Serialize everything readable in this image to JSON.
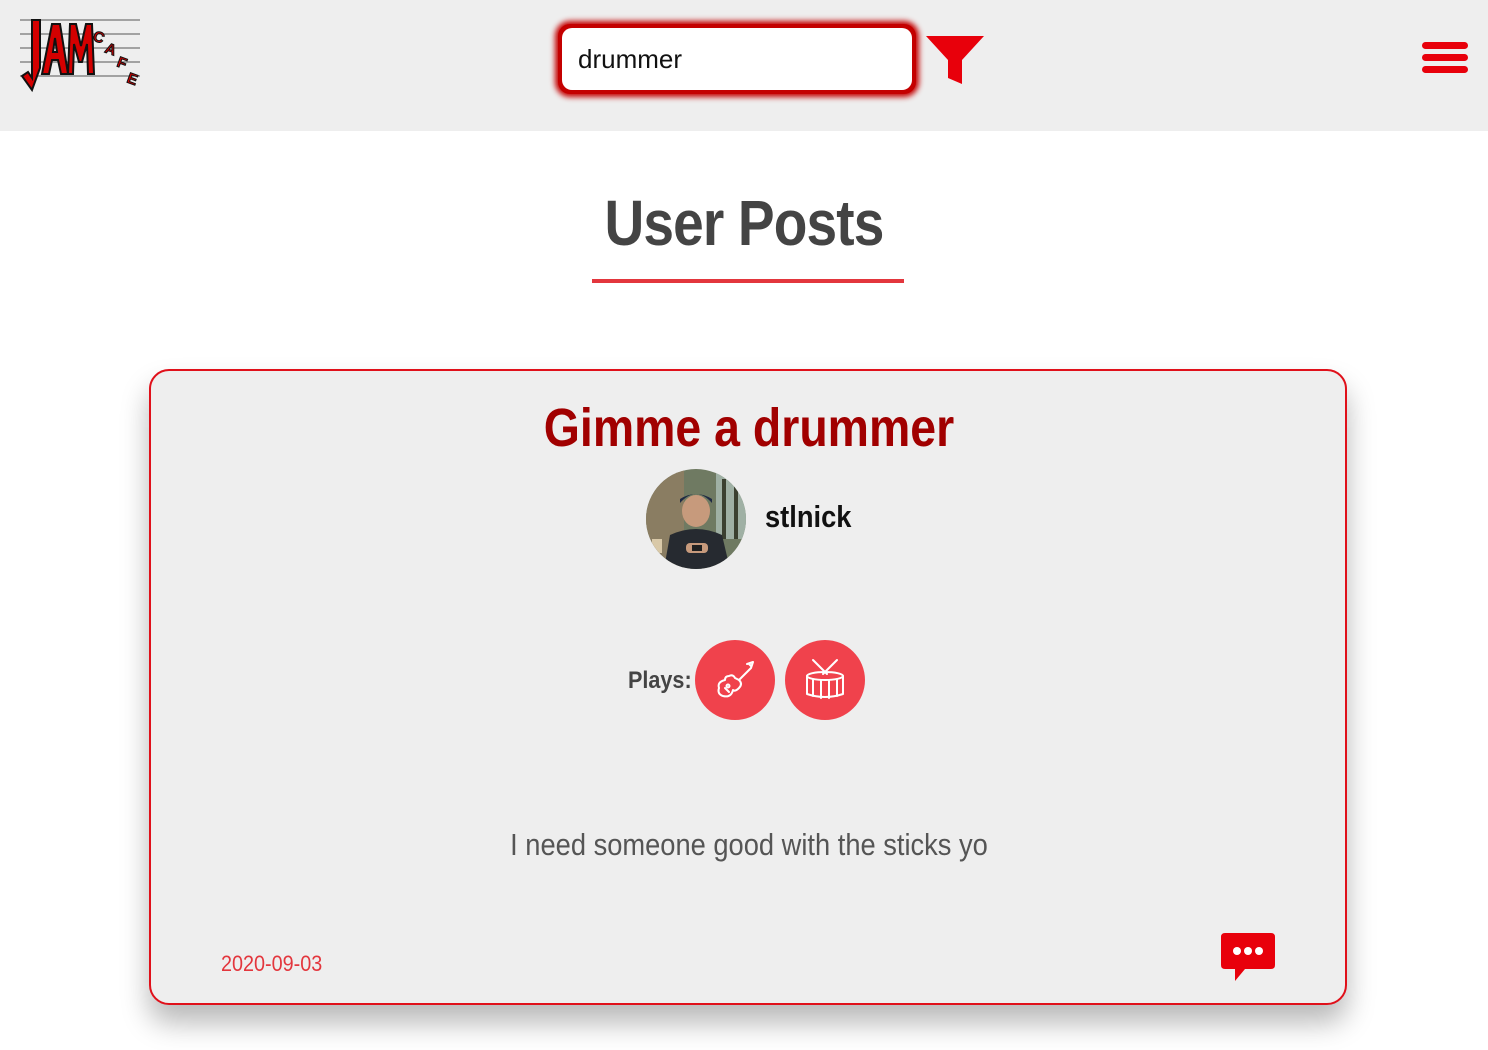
{
  "header": {
    "logo_text": "JAM CAFE",
    "search": {
      "value": "drummer",
      "placeholder": ""
    },
    "icons": {
      "filter": "filter-funnel-icon",
      "menu": "hamburger-menu-icon"
    }
  },
  "page": {
    "title": "User Posts"
  },
  "post": {
    "title": "Gimme a drummer",
    "username": "stlnick",
    "plays_label": "Plays:",
    "instruments": [
      {
        "name": "guitar",
        "icon": "guitar-icon"
      },
      {
        "name": "drums",
        "icon": "drum-icon"
      }
    ],
    "body": "I need someone good with the sticks yo",
    "date": "2020-09-03",
    "comment_icon": "comment-bubble-icon"
  },
  "colors": {
    "accent": "#e8000b",
    "title_red": "#a10000",
    "soft_red": "#f0424c",
    "header_bg": "#eeeeee",
    "heading_gray": "#444444"
  }
}
